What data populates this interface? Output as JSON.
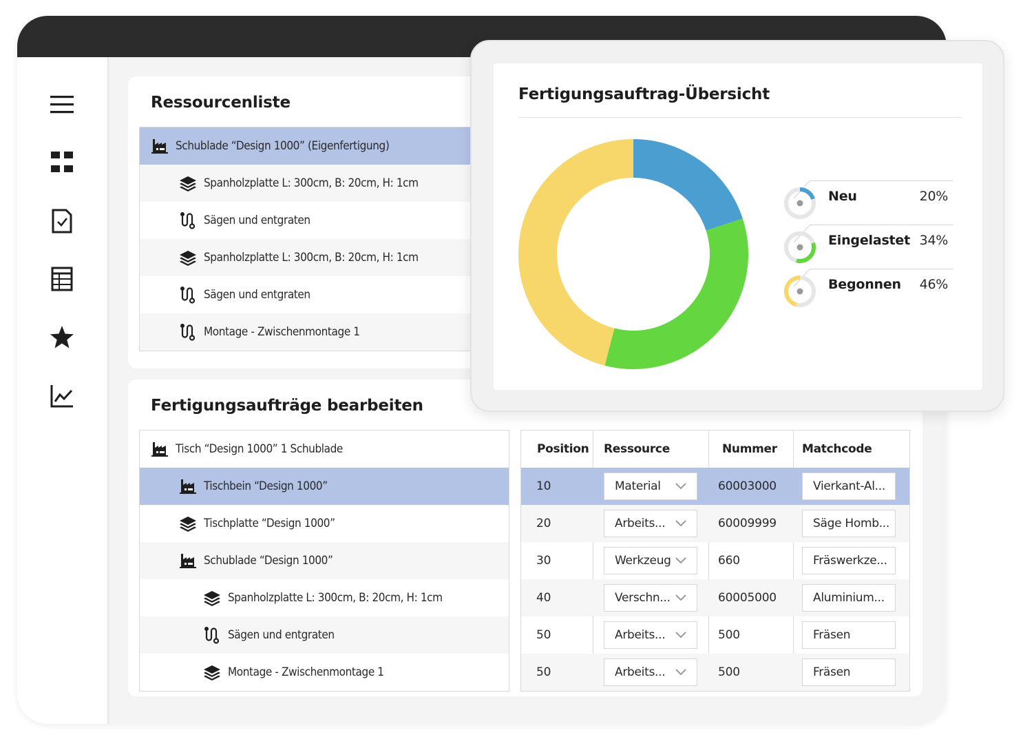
{
  "sidebar": {
    "icons": [
      "hamburger-menu-icon",
      "grid-icon",
      "checked-document-icon",
      "table-icon",
      "star-icon",
      "line-chart-icon"
    ]
  },
  "resource_list": {
    "title": "Ressourcenliste",
    "rows": [
      {
        "icon": "factory-icon",
        "label": "Schublade “Design 1000” (Eigenfertigung)",
        "level": 0,
        "selected": true
      },
      {
        "icon": "layers-icon",
        "label": "Spanholzplatte L: 300cm, B: 20cm, H: 1cm",
        "level": 1
      },
      {
        "icon": "route-icon",
        "label": "Sägen und entgraten",
        "level": 1
      },
      {
        "icon": "layers-icon",
        "label": "Spanholzplatte L: 300cm, B: 20cm, H: 1cm",
        "level": 1
      },
      {
        "icon": "route-icon",
        "label": "Sägen und entgraten",
        "level": 1
      },
      {
        "icon": "route-icon",
        "label": "Montage - Zwischenmontage 1",
        "level": 1
      }
    ]
  },
  "orders": {
    "title": "Fertigungsaufträge bearbeiten",
    "tree": [
      {
        "icon": "factory-icon",
        "label": "Tisch “Design 1000” 1 Schublade",
        "level": 0
      },
      {
        "icon": "factory-icon",
        "label": "Tischbein “Design 1000”",
        "level": 1,
        "selected": true
      },
      {
        "icon": "layers-icon",
        "label": "Tischplatte “Design 1000”",
        "level": 1
      },
      {
        "icon": "factory-icon",
        "label": "Schublade “Design 1000”",
        "level": 1
      },
      {
        "icon": "layers-icon",
        "label": "Spanholzplatte L: 300cm, B: 20cm, H: 1cm",
        "level": 2
      },
      {
        "icon": "route-icon",
        "label": "Sägen und entgraten",
        "level": 2
      },
      {
        "icon": "layers-icon",
        "label": "Montage - Zwischenmontage 1",
        "level": 2
      }
    ],
    "table": {
      "headers": {
        "position": "Position",
        "resource": "Ressource",
        "number": "Nummer",
        "matchcode": "Matchcode"
      },
      "rows": [
        {
          "position": "10",
          "resource": "Material",
          "number": "60003000",
          "matchcode": "Vierkant-Al...",
          "selected": true
        },
        {
          "position": "20",
          "resource": "Arbeits...",
          "number": "60009999",
          "matchcode": "Säge Homb..."
        },
        {
          "position": "30",
          "resource": "Werkzeug",
          "number": "660",
          "matchcode": "Fräswerkze..."
        },
        {
          "position": "40",
          "resource": "Verschn...",
          "number": "60005000",
          "matchcode": "Aluminium..."
        },
        {
          "position": "50",
          "resource": "Arbeits...",
          "number": "500",
          "matchcode": "Fräsen"
        },
        {
          "position": "50",
          "resource": "Arbeits...",
          "number": "500",
          "matchcode": "Fräsen"
        }
      ]
    }
  },
  "overview": {
    "title": "Fertigungsauftrag-Übersicht",
    "legend": [
      {
        "name": "Neu",
        "pct": "20%"
      },
      {
        "name": "Eingelastet",
        "pct": "34%"
      },
      {
        "name": "Begonnen",
        "pct": "46%"
      }
    ]
  },
  "chart_data": {
    "type": "pie",
    "donut": true,
    "series": [
      {
        "name": "Neu",
        "value": 20,
        "color": "#4a9fd0"
      },
      {
        "name": "Eingelastet",
        "value": 34,
        "color": "#64d640"
      },
      {
        "name": "Begonnen",
        "value": 46,
        "color": "#f8d76a"
      }
    ]
  }
}
